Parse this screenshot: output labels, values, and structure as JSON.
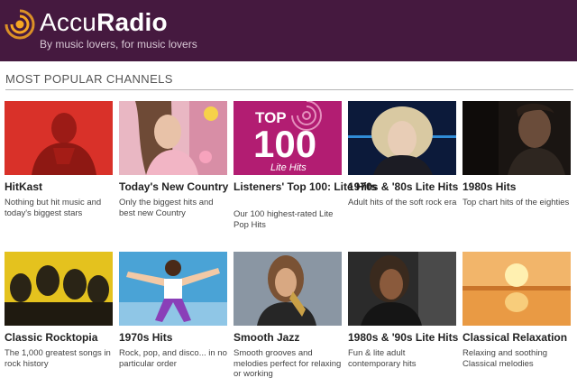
{
  "header": {
    "brand_light": "Accu",
    "brand_bold": "Radio",
    "tagline": "By music lovers, for music lovers",
    "bg_color": "#45193f",
    "accent_color": "#f5a623"
  },
  "section": {
    "title": "MOST POPULAR CHANNELS"
  },
  "top100_thumb": {
    "top_text": "TOP",
    "number_text": "100",
    "sub_text": "Lite Hits"
  },
  "channels": [
    {
      "title": "HitKast",
      "description": "Nothing but hit music and today's biggest stars",
      "thumb_icon": "photo-red-artist-icon"
    },
    {
      "title": "Today's New Country",
      "description": "Only the biggest hits and best new Country",
      "thumb_icon": "photo-country-artist-icon"
    },
    {
      "title": "Listeners' Top 100: Lite Hits",
      "description": "Our 100 highest-rated Lite Pop Hits",
      "thumb_icon": "top100-logo-icon"
    },
    {
      "title": "1970s & '80s Lite Hits",
      "description": "Adult hits of the soft rock era",
      "thumb_icon": "photo-blonde-singer-icon"
    },
    {
      "title": "1980s Hits",
      "description": "Top chart hits of the eighties",
      "thumb_icon": "photo-80s-singer-icon"
    },
    {
      "title": "Classic Rocktopia",
      "description": "The 1,000 greatest songs in rock history",
      "thumb_icon": "photo-rock-band-icon"
    },
    {
      "title": "1970s Hits",
      "description": "Rock, pop, and disco... in no particular order",
      "thumb_icon": "photo-jumping-performer-icon"
    },
    {
      "title": "Smooth Jazz",
      "description": "Smooth grooves and melodies perfect for relaxing or working",
      "thumb_icon": "photo-saxophonist-icon"
    },
    {
      "title": "1980s & '90s Lite Hits",
      "description": "Fun & lite adult contemporary hits",
      "thumb_icon": "photo-diva-singer-icon"
    },
    {
      "title": "Classical Relaxation",
      "description": "Relaxing and soothing Classical melodies",
      "thumb_icon": "photo-sunset-reflection-icon"
    }
  ]
}
